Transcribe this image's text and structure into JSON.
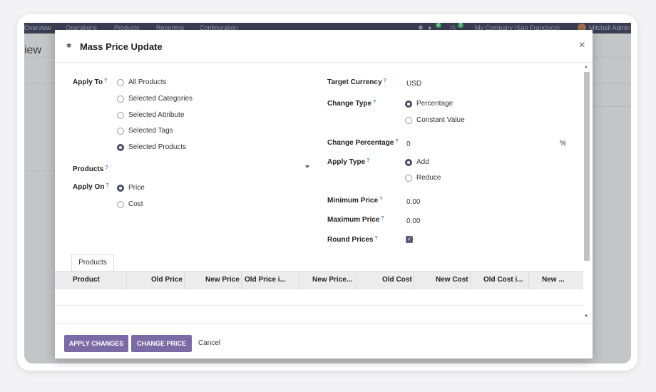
{
  "background_app": {
    "nav_items": [
      "Overview",
      "Operations",
      "Products",
      "Reporting",
      "Configuration"
    ],
    "badge_messages": "4",
    "badge_activities": "2",
    "company": "My Company (San Francisco)",
    "user": "Mitchell Admin",
    "page_title": "iew"
  },
  "dialog": {
    "title": "Mass Price Update",
    "close_label": "×",
    "apply_to": {
      "label": "Apply To",
      "options": [
        "All Products",
        "Selected Categories",
        "Selected Attribute",
        "Selected Tags",
        "Selected Products"
      ],
      "selected": "Selected Products"
    },
    "products_label": "Products",
    "products_value": "",
    "apply_on": {
      "label": "Apply On",
      "options": [
        "Price",
        "Cost"
      ],
      "selected": "Price"
    },
    "target_currency": {
      "label": "Target Currency",
      "value": "USD"
    },
    "change_type": {
      "label": "Change Type",
      "options": [
        "Percentage",
        "Constant Value"
      ],
      "selected": "Percentage"
    },
    "change_percentage": {
      "label": "Change Percentage",
      "value": "0",
      "unit": "%"
    },
    "apply_type": {
      "label": "Apply Type",
      "options": [
        "Add",
        "Reduce"
      ],
      "selected": "Add"
    },
    "minimum_price": {
      "label": "Minimum Price",
      "value": "0.00"
    },
    "maximum_price": {
      "label": "Maximum Price",
      "value": "0.00"
    },
    "round_prices": {
      "label": "Round Prices",
      "checked": true
    },
    "help_mark": "?",
    "tab_label": "Products",
    "table_columns": [
      "Product",
      "Old Price",
      "New Price",
      "Old Price i...",
      "New Price...",
      "Old Cost",
      "New Cost",
      "Old Cost i...",
      "New ..."
    ],
    "footer": {
      "apply_changes": "APPLY CHANGES",
      "change_price": "CHANGE PRICE",
      "cancel": "Cancel"
    }
  }
}
